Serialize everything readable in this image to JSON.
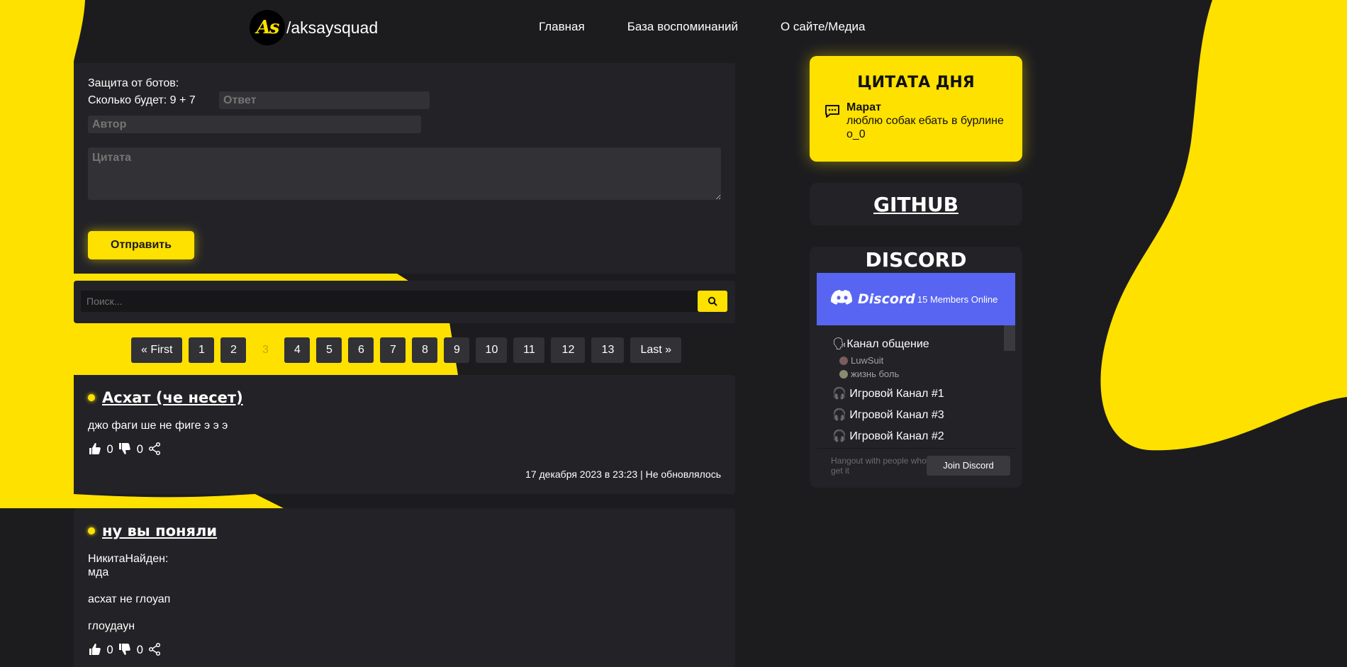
{
  "header": {
    "logo_badge": "As",
    "logo_text": "/aksaysquad",
    "nav": [
      "Главная",
      "База воспоминаний",
      "О сайте/Медиа"
    ]
  },
  "form": {
    "bot_title": "Защита от ботов:",
    "bot_question": "Сколько будет: 9 + 7",
    "answer_placeholder": "Ответ",
    "author_placeholder": "Автор",
    "quote_placeholder": "Цитата",
    "submit_label": "Отправить"
  },
  "search": {
    "placeholder": "Поиск..."
  },
  "pagination": {
    "first": "« First",
    "pages": [
      "1",
      "2",
      "3",
      "4",
      "5",
      "6",
      "7",
      "8",
      "9",
      "10",
      "11",
      "12",
      "13"
    ],
    "current": "3",
    "last": "Last »"
  },
  "posts": [
    {
      "title": "Асхат (че несет)",
      "lines": [
        "джо фаги ше не фиге э э э"
      ],
      "likes": "0",
      "dislikes": "0",
      "meta": "17 декабря 2023 в 23:23 | Не обновлялось"
    },
    {
      "title": "ну вы поняли",
      "lines": [
        "НикитаНайден:\nмда",
        "асхат не глоуап",
        "глоудаун"
      ],
      "likes": "0",
      "dislikes": "0"
    }
  ],
  "sidebar": {
    "quote_of_day": {
      "title": "ЦИТАТА ДНЯ",
      "author": "Марат",
      "text": "люблю собак ебать в бурлине о_0"
    },
    "github": {
      "label": "GITHUB"
    },
    "discord": {
      "title": "DISCORD",
      "brand": "Discord",
      "online": "15 Members Online",
      "channels": [
        {
          "name": "🗣Канал общение",
          "members": [
            "LuwSuit",
            "жизнь боль"
          ]
        },
        {
          "name": "🎧 Игровой Канал #1",
          "members": []
        },
        {
          "name": "🎧 Игровой Канал #3",
          "members": []
        },
        {
          "name": "🎧 Игровой Канал #2",
          "members": []
        }
      ],
      "footer_text": "Hangout with people who get it",
      "join_label": "Join Discord"
    }
  },
  "colors": {
    "accent": "#ffe100",
    "background": "#1c1c1f",
    "panel": "#232327",
    "discord": "#5865f2"
  }
}
